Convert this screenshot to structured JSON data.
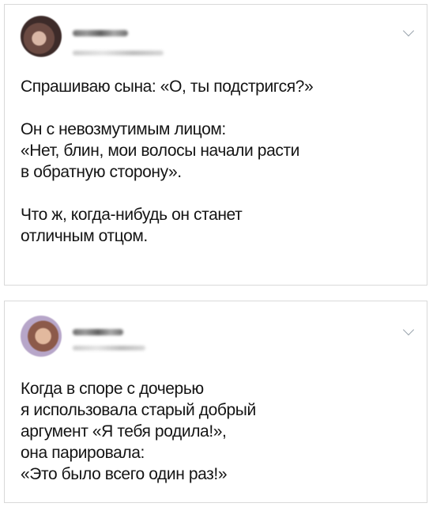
{
  "tweets": [
    {
      "text": "Спрашиваю сына: «О, ты подстригся?»\n\nОн с невозмутимым лицом:\n«Нет, блин, мои волосы начали расти\nв обратную сторону».\n\nЧто ж, когда-нибудь он станет\nотличным отцом."
    },
    {
      "text": "Когда в споре с дочерью\nя использовала старый добрый\nаргумент «Я тебя родила!»,\nона парировала:\n«Это было всего один раз!»"
    }
  ],
  "icons": {
    "menu": "chevron-down-icon"
  }
}
